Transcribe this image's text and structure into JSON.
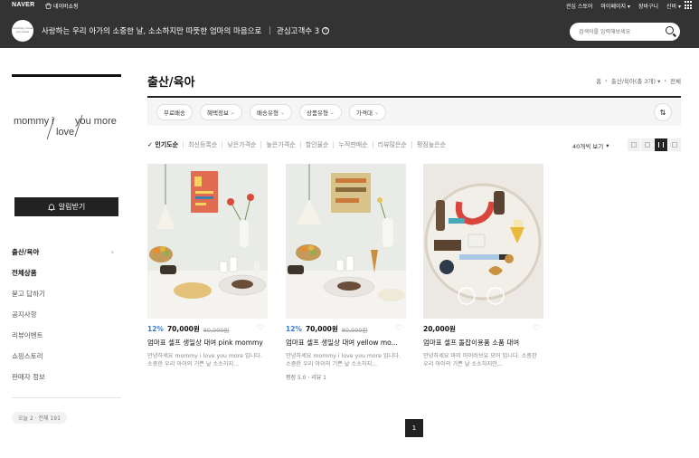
{
  "topbar": {
    "naver": "NAVER",
    "shopping": "네이버쇼핑",
    "right_items": [
      "관심 스토어",
      "마이페이지 ▾",
      "장바구니",
      "신비 ▾"
    ]
  },
  "header": {
    "logo_text": "mommy i love you more",
    "slogan": "사랑하는 우리 아가의 소중한 날, 소소하지만 따뜻한 엄마의 마음으로",
    "interest_label": "관심고객수 3",
    "interest_icon": "?"
  },
  "search": {
    "placeholder": "검색어를 입력해보세요"
  },
  "sidebar": {
    "brand_line1": "mommy i",
    "brand_line2": "love",
    "brand_line3": "you more",
    "alarm_label": "알림받기",
    "menu": [
      {
        "label": "출산/육아",
        "bold": true,
        "arrow": "›"
      },
      {
        "label": "전체상품",
        "bold": true
      },
      {
        "label": "묻고 답하기"
      },
      {
        "label": "공지사항"
      },
      {
        "label": "리뷰이벤트"
      },
      {
        "label": "쇼핑스토리"
      },
      {
        "label": "판매자 정보"
      }
    ],
    "visits": "오늘 2 · 전체 191"
  },
  "main": {
    "title": "출산/육아",
    "breadcrumb": [
      "홈",
      "›",
      "출산/육아(총 3개) ▾",
      "›",
      "전체"
    ]
  },
  "filters": {
    "chips": [
      "무료배송",
      "혜택정보",
      "배송유형",
      "상품유형",
      "가격대"
    ],
    "chip_has_arrow": [
      false,
      true,
      true,
      true,
      true
    ]
  },
  "sort": {
    "options": [
      "인기도순",
      "최신등록순",
      "낮은가격순",
      "높은가격순",
      "할인율순",
      "누적판매순",
      "리뷰많은순",
      "평점높은순"
    ],
    "selected_index": 0,
    "per_page": "40개씩 보기"
  },
  "products": [
    {
      "discount": "12%",
      "price": "70,000원",
      "original": "80,000원",
      "name": "엄마표 셀프 생일상 대여 pink mommy",
      "desc": "안녕하세요 mommy i love you more 입니다. 소중한 우리 아이의 기쁜 날 소소하지...",
      "review": ""
    },
    {
      "discount": "12%",
      "price": "70,000원",
      "original": "80,000원",
      "name": "엄마표 셀프 생일상 대여 yellow mo...",
      "desc": "안녕하세요 mommy i love you more 입니다. 소중한 우리 아이의 기쁜 날 소소하지...",
      "review": "평점 5.0 · 리뷰 1"
    },
    {
      "discount": "",
      "price": "20,000원",
      "original": "",
      "name": "엄마표 셀프 돌잡이용품 소품 대여",
      "desc": "안녕하세요 마미 아이러브유 모어 입니다. 소중한 우리 아이의 기쁜 날 소소하지만...",
      "review": ""
    }
  ],
  "pagination": {
    "current": "1"
  },
  "colors": {
    "header_bg": "#333333",
    "discount": "#3b7bd1"
  }
}
